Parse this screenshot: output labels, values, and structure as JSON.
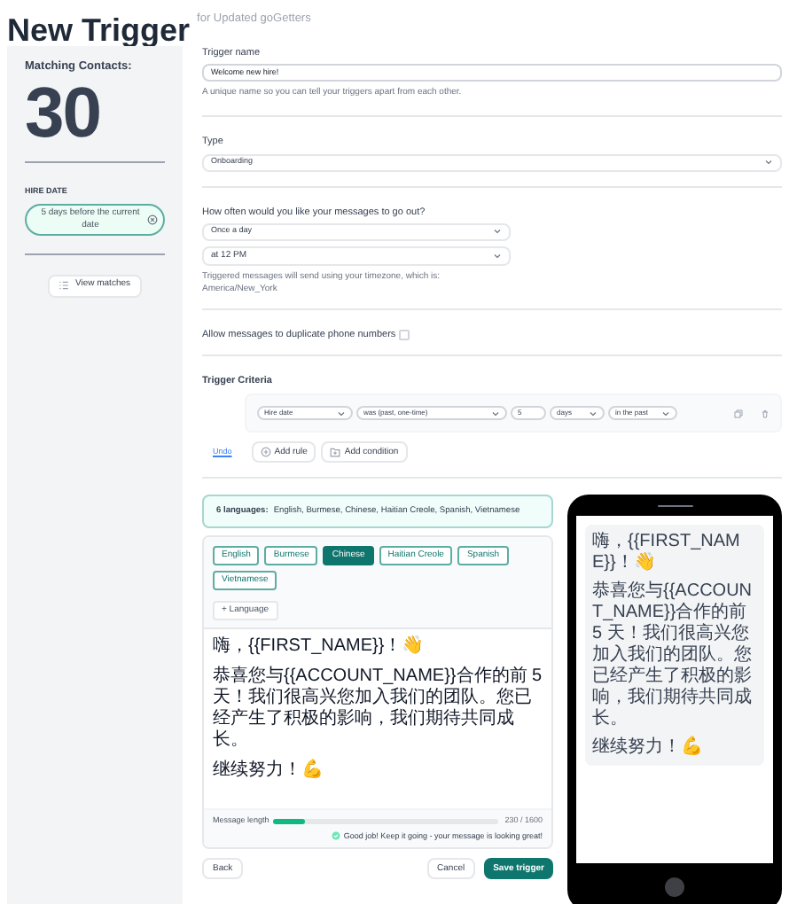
{
  "header": {
    "title": "New Trigger",
    "subtitle": "for Updated goGetters"
  },
  "sidebar": {
    "heading": "Matching Contacts:",
    "count": "30",
    "filter_label": "HIRE DATE",
    "filter_chip": "5 days before the current date",
    "view_button": "View matches"
  },
  "trigger_name": {
    "label": "Trigger name",
    "value": "Welcome new hire!",
    "help": "A unique name so you can tell your triggers apart from each other."
  },
  "type": {
    "label": "Type",
    "value": "Onboarding"
  },
  "frequency": {
    "label": "How often would you like your messages to go out?",
    "value": "Once a day",
    "time": "at 12 PM",
    "help": "Triggered messages will send using your timezone, which is: America/New_York"
  },
  "duplicates": {
    "label": "Allow messages to duplicate phone numbers",
    "checked": false
  },
  "criteria": {
    "label": "Trigger Criteria",
    "fields": [
      {
        "kind": "select",
        "value": "Hire date"
      },
      {
        "kind": "select",
        "value": "was (past, one-time)"
      },
      {
        "kind": "input",
        "value": "5"
      },
      {
        "kind": "select",
        "value": "days"
      },
      {
        "kind": "select",
        "value": "in the past"
      }
    ],
    "undo": "Undo",
    "add_rule": "Add rule",
    "add_condition": "Add condition"
  },
  "languages": {
    "count_label": "6 languages:",
    "list": "English, Burmese, Chinese, Haitian Creole, Spanish, Vietnamese",
    "tabs": [
      {
        "label": "English",
        "selected": false
      },
      {
        "label": "Burmese",
        "selected": false
      },
      {
        "label": "Chinese",
        "selected": true
      },
      {
        "label": "Haitian Creole",
        "selected": false
      },
      {
        "label": "Spanish",
        "selected": false
      },
      {
        "label": "Vietnamese",
        "selected": false
      }
    ],
    "add": "+ Language"
  },
  "message": {
    "paragraphs": [
      "嗨，{{FIRST_NAME}}！👋",
      "恭喜您与{{ACCOUNT_NAME}}合作的前 5 天！我们很高兴您加入我们的团队。您已经产生了积极的影响，我们期待共同成长。",
      "继续努力！💪"
    ],
    "length_label": "Message length",
    "level": 0.144,
    "reading": "230 / 1600",
    "feedback": "Good job! Keep it going - your message is looking great!"
  },
  "buttons": {
    "back": "Back",
    "cancel": "Cancel",
    "save": "Save trigger"
  },
  "phone": {
    "paragraphs": [
      "嗨，{{FIRST_NAME}}！👋",
      "恭喜您与{{ACCOUNT_NAME}}合作的前 5 天！我们很高兴您加入我们的团队。您已经产生了积极的影响，我们期待共同成长。",
      "继续努力！💪"
    ]
  }
}
